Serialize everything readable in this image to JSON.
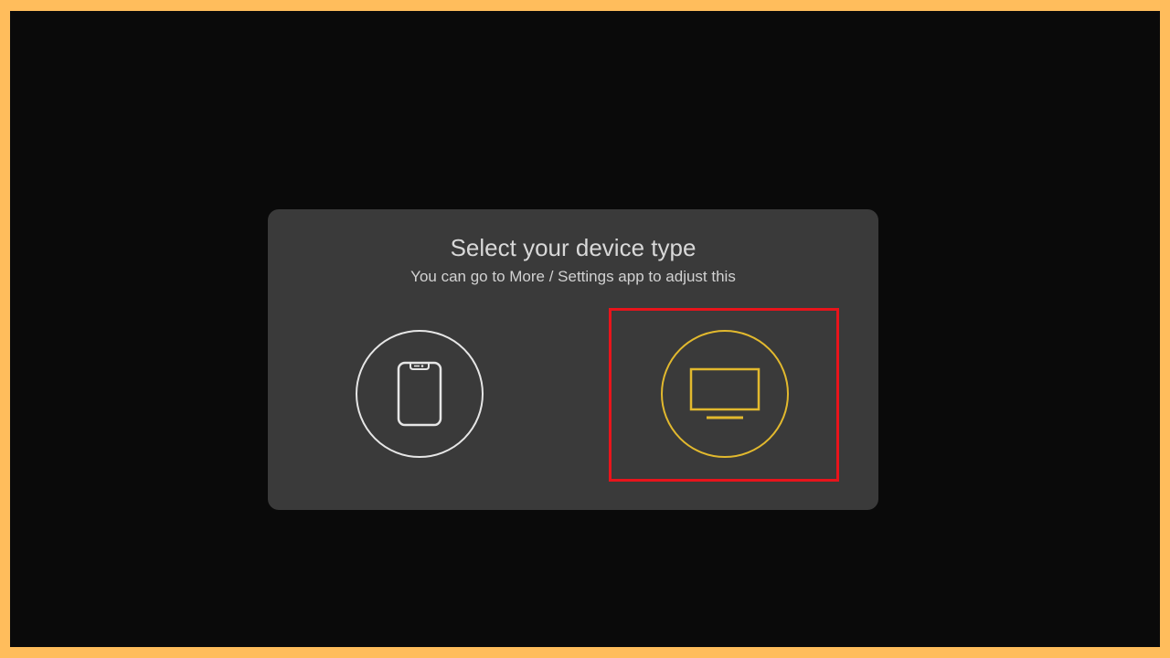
{
  "dialog": {
    "title": "Select your device type",
    "subtitle": "You can go to More / Settings app to adjust this"
  },
  "options": [
    {
      "name": "phone",
      "icon": "phone-icon",
      "color": "#e6e6e6",
      "selected": false
    },
    {
      "name": "tv",
      "icon": "tv-icon",
      "color": "#e2b92e",
      "selected": true
    }
  ],
  "colors": {
    "frame": "#ffbd5c",
    "background": "#0a0a0a",
    "dialog": "#3a3a3a",
    "accent": "#e2b92e",
    "highlight": "#e8141b"
  }
}
